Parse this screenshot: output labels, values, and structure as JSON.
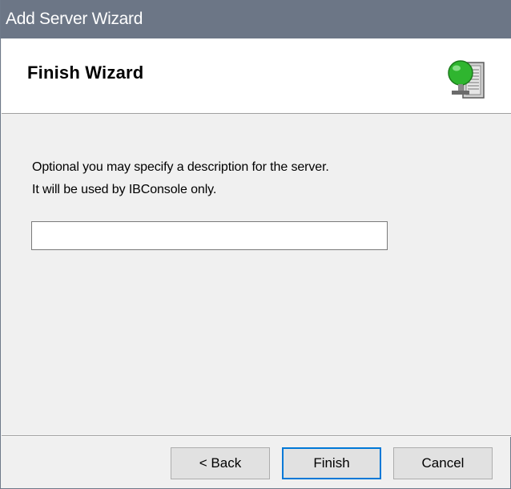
{
  "window": {
    "title": "Add Server Wizard"
  },
  "header": {
    "title": "Finish Wizard",
    "icon": "server-globe-icon"
  },
  "content": {
    "description_line1": "Optional you may specify a description for the server.",
    "description_line2": "It will be used by IBConsole only.",
    "description_input": {
      "value": "",
      "placeholder": ""
    }
  },
  "buttons": {
    "back_label": "< Back",
    "finish_label": "Finish",
    "cancel_label": "Cancel"
  },
  "colors": {
    "titlebar": "#6c7686",
    "focus_border": "#0078d7",
    "globe_green": "#2fb52f"
  }
}
